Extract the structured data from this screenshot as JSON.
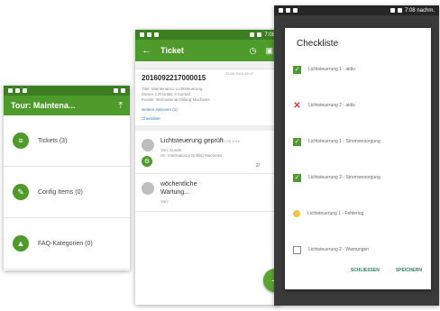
{
  "phone1": {
    "status_right": "",
    "title": "Tour: Maintena...",
    "menu": [
      {
        "label": "Tickets (3)",
        "icon": "list-icon"
      },
      {
        "label": "Config Items (0)",
        "icon": "wrench-icon"
      },
      {
        "label": "FAQ-Kategorien (0)",
        "icon": "graduation-cap-icon"
      }
    ]
  },
  "phone2": {
    "status_right": "7:08",
    "title": "Ticket",
    "ticket_number": "2016092217000015",
    "ticket_date": "22.09.2016 08:47",
    "ticket_info": [
      "Titel: Maintenance Lichtsteuerung",
      "Owner 2 Priorität: 3 normal",
      "Kunde: International Drilling Machines"
    ],
    "ticket_link": "weitere Aktionen (1)",
    "ticket_link2": "Checkliste",
    "ticket_count": "2/",
    "tasks": [
      {
        "title": "Lichtsteuerung geprüft",
        "date": "22.09.2016",
        "sub": [
          "Von: Kunde",
          "An: International Drilling Machines"
        ]
      },
      {
        "title": "wöchentliche Wartung...",
        "date": "",
        "sub": [
          "Von:"
        ]
      }
    ]
  },
  "phone3": {
    "status_right": "7:08 nachm.",
    "dialog_title": "Checkliste",
    "items": [
      {
        "label": "Lichtsteuerung 1 - aktiv",
        "state": "checked"
      },
      {
        "label": "Lichtsteuerung 2 - aktiv",
        "state": "failed"
      },
      {
        "label": "Lichtsteuerung 1 - Stromversorgung",
        "state": "checked"
      },
      {
        "label": "Lichtsteuerung 2 - Stromversorgung",
        "state": "checked"
      },
      {
        "label": "Lichtsteuerung 1 - Fehlerlog",
        "state": "pending"
      },
      {
        "label": "Lichtsteuerung 2 - Warnungen",
        "state": "unchecked"
      }
    ],
    "close_label": "SCHLIESSEN",
    "save_label": "SPEICHERN"
  },
  "colors": {
    "brand_green": "#4e9a2a",
    "dark_green": "#3e7e22",
    "error_red": "#e0393e",
    "pending_yellow": "#f3c347"
  }
}
